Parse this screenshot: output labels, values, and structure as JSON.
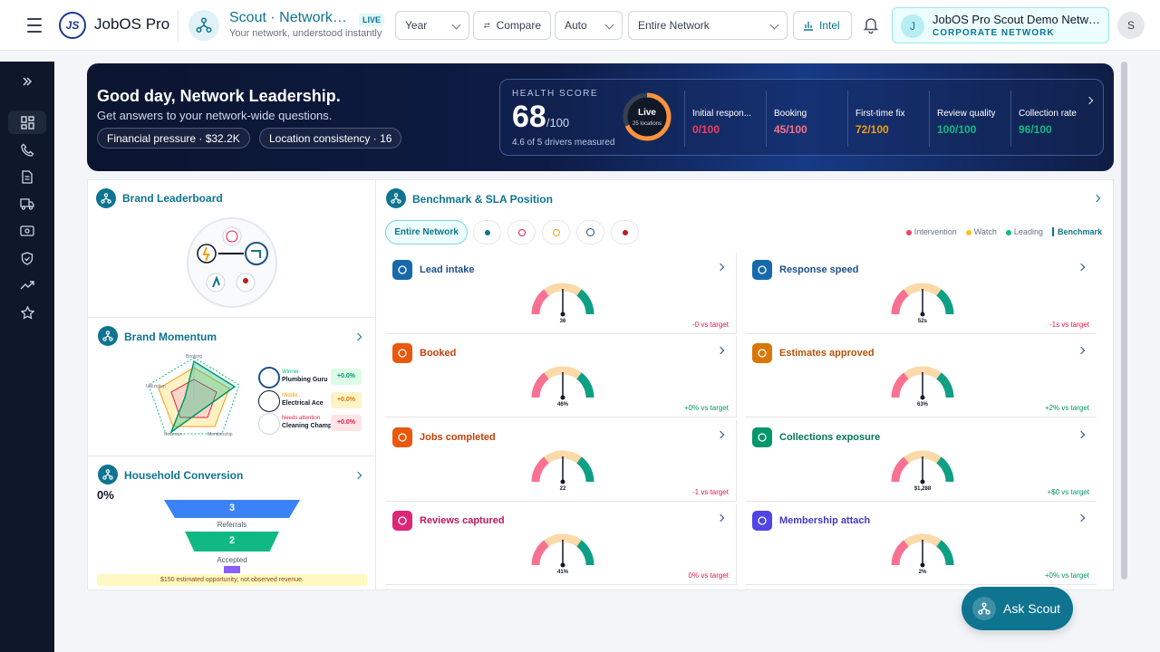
{
  "header": {
    "brand": "JobOS Pro",
    "logo_text": "JS",
    "scout_title": "Scout · Network Pulse",
    "live_badge": "LIVE",
    "scout_subtitle": "Your network, understood instantly",
    "period": "Year",
    "compare": "Compare",
    "mode": "Auto",
    "scope": "Entire Network",
    "intel": "Intel",
    "org_avatar": "J",
    "org_name": "JobOS Pro Scout Demo Network",
    "org_type": "CORPORATE NETWORK",
    "user_avatar": "S"
  },
  "hero": {
    "greeting": "Good day, Network Leadership.",
    "subtitle": "Get answers to your network-wide questions.",
    "pills": [
      "Financial pressure · $32.2K",
      "Location consistency · 16"
    ],
    "health_label": "HEALTH SCORE",
    "score": "68",
    "score_max": "/100",
    "drivers": "4.6 of 5 drivers measured",
    "ring_label": "Live",
    "ring_sub": "25 locations",
    "metrics": [
      {
        "label": "Initial respon...",
        "value": "0/100",
        "color": "#f43f5e"
      },
      {
        "label": "Booking",
        "value": "45/100",
        "color": "#fb7185"
      },
      {
        "label": "First-time fix",
        "value": "72/100",
        "color": "#f59e0b"
      },
      {
        "label": "Review quality",
        "value": "100/100",
        "color": "#10b981"
      },
      {
        "label": "Collection rate",
        "value": "96/100",
        "color": "#10b981"
      }
    ]
  },
  "left": {
    "leaderboard_title": "Brand Leaderboard",
    "momentum_title": "Brand Momentum",
    "momentum": [
      {
        "tag": "Winner",
        "name": "Plumbing Guru",
        "delta": "+0.0%",
        "tagcolor": "#10b981",
        "bg": "#dcfce7"
      },
      {
        "tag": "Middle",
        "name": "Electrical Ace",
        "delta": "+0.0%",
        "tagcolor": "#f59e0b",
        "bg": "#fef3c7"
      },
      {
        "tag": "Needs attention",
        "name": "Cleaning Champs",
        "delta": "+0.0%",
        "tagcolor": "#e11d48",
        "bg": "#ffe4e6"
      }
    ],
    "radar_labels": [
      "Booking",
      "Utilization",
      "Revenue",
      "Membership"
    ],
    "conversion_title": "Household Conversion",
    "conversion_pct": "0%",
    "funnel": [
      {
        "value": "3",
        "label": "Referrals"
      },
      {
        "value": "2",
        "label": "Accepted"
      }
    ],
    "note": "$150 estimated opportunity; not observed revenue."
  },
  "benchmark": {
    "title": "Benchmark & SLA Position",
    "filter": "Entire Network",
    "legend": [
      "Intervention",
      "Watch",
      "Leading",
      "Benchmark"
    ],
    "tiles": [
      {
        "name": "Lead intake",
        "value": "-0 vs target",
        "center": "36",
        "color": "#1f4f8a",
        "vcolor": "#e11d48",
        "ibg": "#1769aa"
      },
      {
        "name": "Response speed",
        "value": "-1s vs target",
        "center": "52s",
        "color": "#1f4f8a",
        "vcolor": "#e11d48",
        "ibg": "#1769aa"
      },
      {
        "name": "Booked",
        "value": "+0% vs target",
        "center": "46%",
        "color": "#c2410c",
        "vcolor": "#059669",
        "ibg": "#ea580c"
      },
      {
        "name": "Estimates approved",
        "value": "+2% vs target",
        "center": "63%",
        "color": "#b45309",
        "vcolor": "#059669",
        "ibg": "#d97706"
      },
      {
        "name": "Jobs completed",
        "value": "-1 vs target",
        "center": "22",
        "color": "#c2410c",
        "vcolor": "#e11d48",
        "ibg": "#ea580c"
      },
      {
        "name": "Collections exposure",
        "value": "+$0 vs target",
        "center": "$1,288",
        "color": "#047857",
        "vcolor": "#059669",
        "ibg": "#059669"
      },
      {
        "name": "Reviews captured",
        "value": "0% vs target",
        "center": "41%",
        "color": "#be185d",
        "vcolor": "#e11d48",
        "ibg": "#db2777"
      },
      {
        "name": "Membership attach",
        "value": "+0% vs target",
        "center": "2%",
        "color": "#4338ca",
        "vcolor": "#059669",
        "ibg": "#4f46e5"
      }
    ]
  },
  "ask": "Ask Scout"
}
